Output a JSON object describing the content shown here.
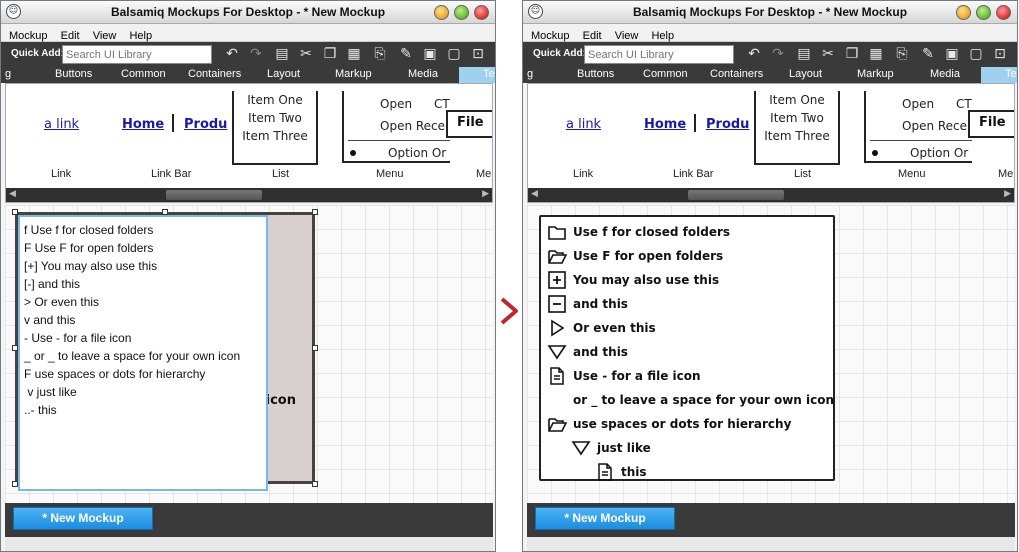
{
  "app": {
    "title": "Balsamiq Mockups For Desktop - * New Mockup",
    "menu": [
      "Mockup",
      "Edit",
      "View",
      "Help"
    ],
    "quick_add_label": "Quick Add:",
    "search_placeholder": "Search UI Library",
    "categories": [
      "g",
      "Buttons",
      "Common",
      "Containers",
      "Layout",
      "Markup",
      "Media",
      "Te"
    ],
    "library": {
      "link_text": "a link",
      "linkbar_items": [
        "Home",
        "Produ"
      ],
      "list_items": [
        "Item One",
        "Item Two",
        "Item Three"
      ],
      "menu_items": [
        "Open",
        "CT",
        "Open Rece",
        "Option Or"
      ],
      "file_label": "File",
      "component_labels": [
        "Link",
        "Link Bar",
        "List",
        "Menu",
        "Me"
      ]
    },
    "new_mockup_button": "* New Mockup"
  },
  "left_editor": {
    "lines": [
      "f Use f for closed folders",
      "F Use F for open folders",
      "[+] You may also use this",
      "[-] and this",
      "> Or even this",
      "v and this",
      "- Use - for a file icon",
      "_ or _ to leave a space for your own icon",
      "F use spaces or dots for hierarchy",
      " v just like",
      "..- this"
    ],
    "partial_text": "icon"
  },
  "right_tree": {
    "items": [
      {
        "icon": "closed-folder-icon",
        "text": "Use f for closed folders"
      },
      {
        "icon": "open-folder-icon",
        "text": "Use F for open folders"
      },
      {
        "icon": "plus-box-icon",
        "text": "You may also use this"
      },
      {
        "icon": "minus-box-icon",
        "text": "and this"
      },
      {
        "icon": "triangle-right-icon",
        "text": "Or even this"
      },
      {
        "icon": "triangle-down-icon",
        "text": "and this"
      },
      {
        "icon": "file-icon",
        "text": "Use - for a file icon"
      },
      {
        "icon": "blank-space",
        "text": "or _ to leave a space for your own icon"
      },
      {
        "icon": "open-folder-icon",
        "text": "use spaces or dots for hierarchy"
      },
      {
        "icon": "triangle-down-icon",
        "text": "just like"
      },
      {
        "icon": "file-icon",
        "text": "this"
      }
    ]
  },
  "colors": {
    "toolbar": "#3a3a3a",
    "button": "#1b8ce0",
    "selection": "#77b9e8",
    "arrow": "#c0262d"
  }
}
